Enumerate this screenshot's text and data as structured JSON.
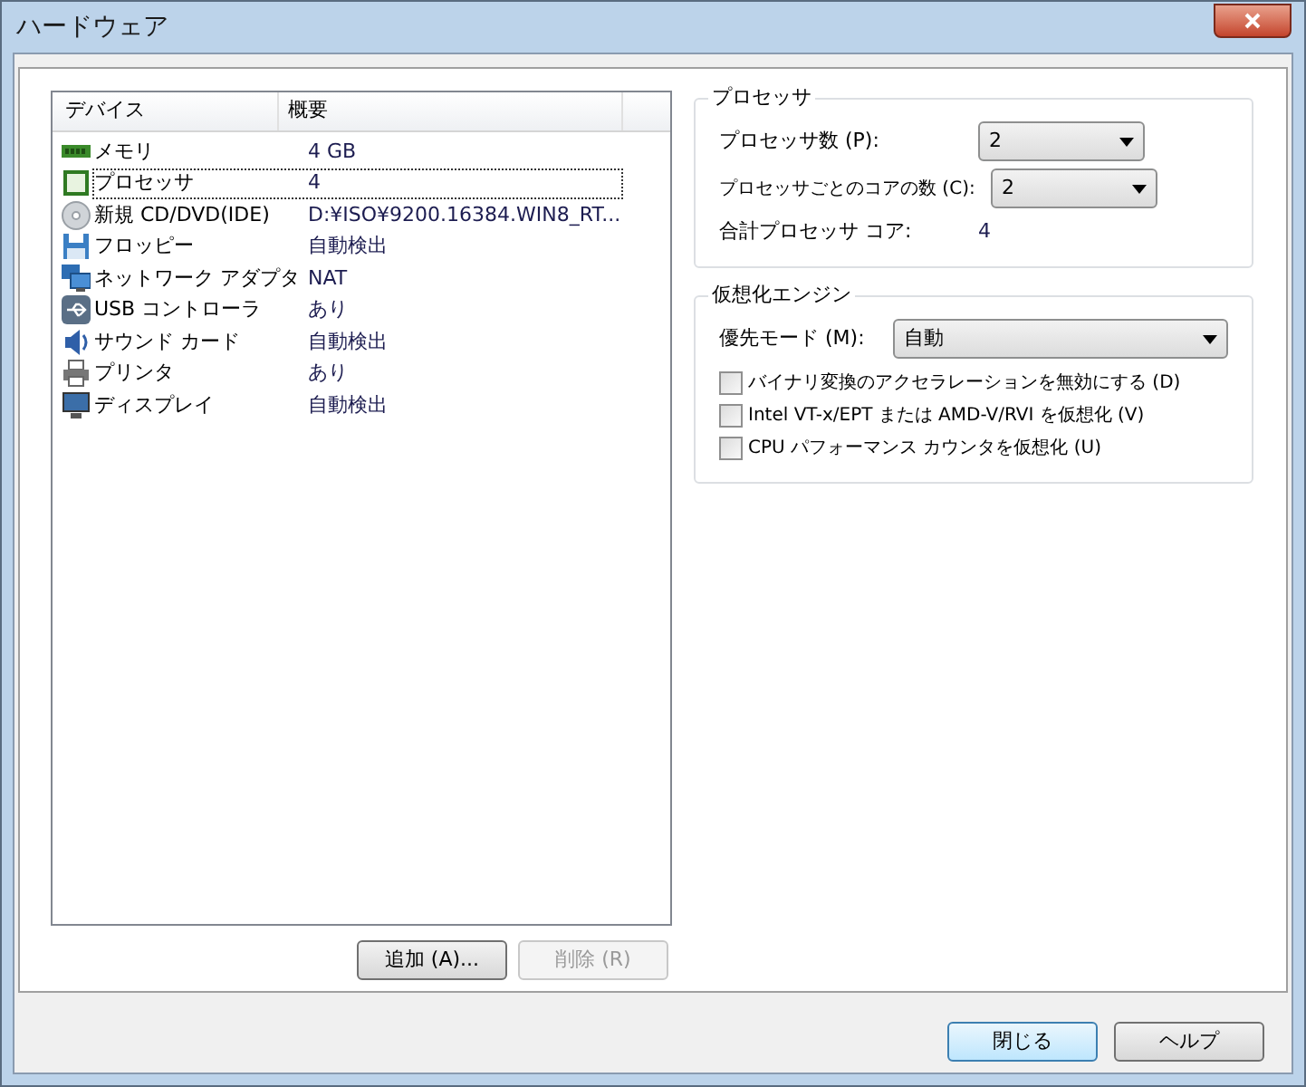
{
  "window": {
    "title": "ハードウェア"
  },
  "device_list": {
    "columns": [
      "デバイス",
      "概要"
    ],
    "rows": [
      {
        "kind": "memory",
        "device": "メモリ",
        "summary": "4 GB",
        "selected": false
      },
      {
        "kind": "cpu",
        "device": "プロセッサ",
        "summary": "4",
        "selected": true
      },
      {
        "kind": "disc",
        "device": "新規 CD/DVD(IDE)",
        "summary": "D:¥ISO¥9200.16384.WIN8_RT...",
        "selected": false
      },
      {
        "kind": "floppy",
        "device": "フロッピー",
        "summary": "自動検出",
        "selected": false
      },
      {
        "kind": "network",
        "device": "ネットワーク アダプタ",
        "summary": "NAT",
        "selected": false
      },
      {
        "kind": "usb",
        "device": "USB コントローラ",
        "summary": "あり",
        "selected": false
      },
      {
        "kind": "sound",
        "device": "サウンド カード",
        "summary": "自動検出",
        "selected": false
      },
      {
        "kind": "printer",
        "device": "プリンタ",
        "summary": "あり",
        "selected": false
      },
      {
        "kind": "display",
        "device": "ディスプレイ",
        "summary": "自動検出",
        "selected": false
      }
    ]
  },
  "list_buttons": [
    {
      "label": "追加 (A)...",
      "disabled": false
    },
    {
      "label": "削除 (R)",
      "disabled": true
    }
  ],
  "processor": {
    "title": "プロセッサ",
    "count_label": "プロセッサ数 (P):",
    "count_value": "2",
    "cores_label": "プロセッサごとのコアの数 (C):",
    "cores_value": "2",
    "total_label": "合計プロセッサ コア:",
    "total_value": "4"
  },
  "virtualization": {
    "title": "仮想化エンジン",
    "mode_label": "優先モード (M):",
    "mode_value": "自動",
    "options": [
      {
        "label": "バイナリ変換のアクセラレーションを無効にする (D)",
        "checked": false
      },
      {
        "label": "Intel VT-x/EPT または AMD-V/RVI を仮想化 (V)",
        "checked": false
      },
      {
        "label": "CPU パフォーマンス カウンタを仮想化 (U)",
        "checked": false
      }
    ]
  },
  "dialog_buttons": [
    {
      "label": "閉じる",
      "default": true
    },
    {
      "label": "ヘルプ",
      "default": false
    }
  ]
}
